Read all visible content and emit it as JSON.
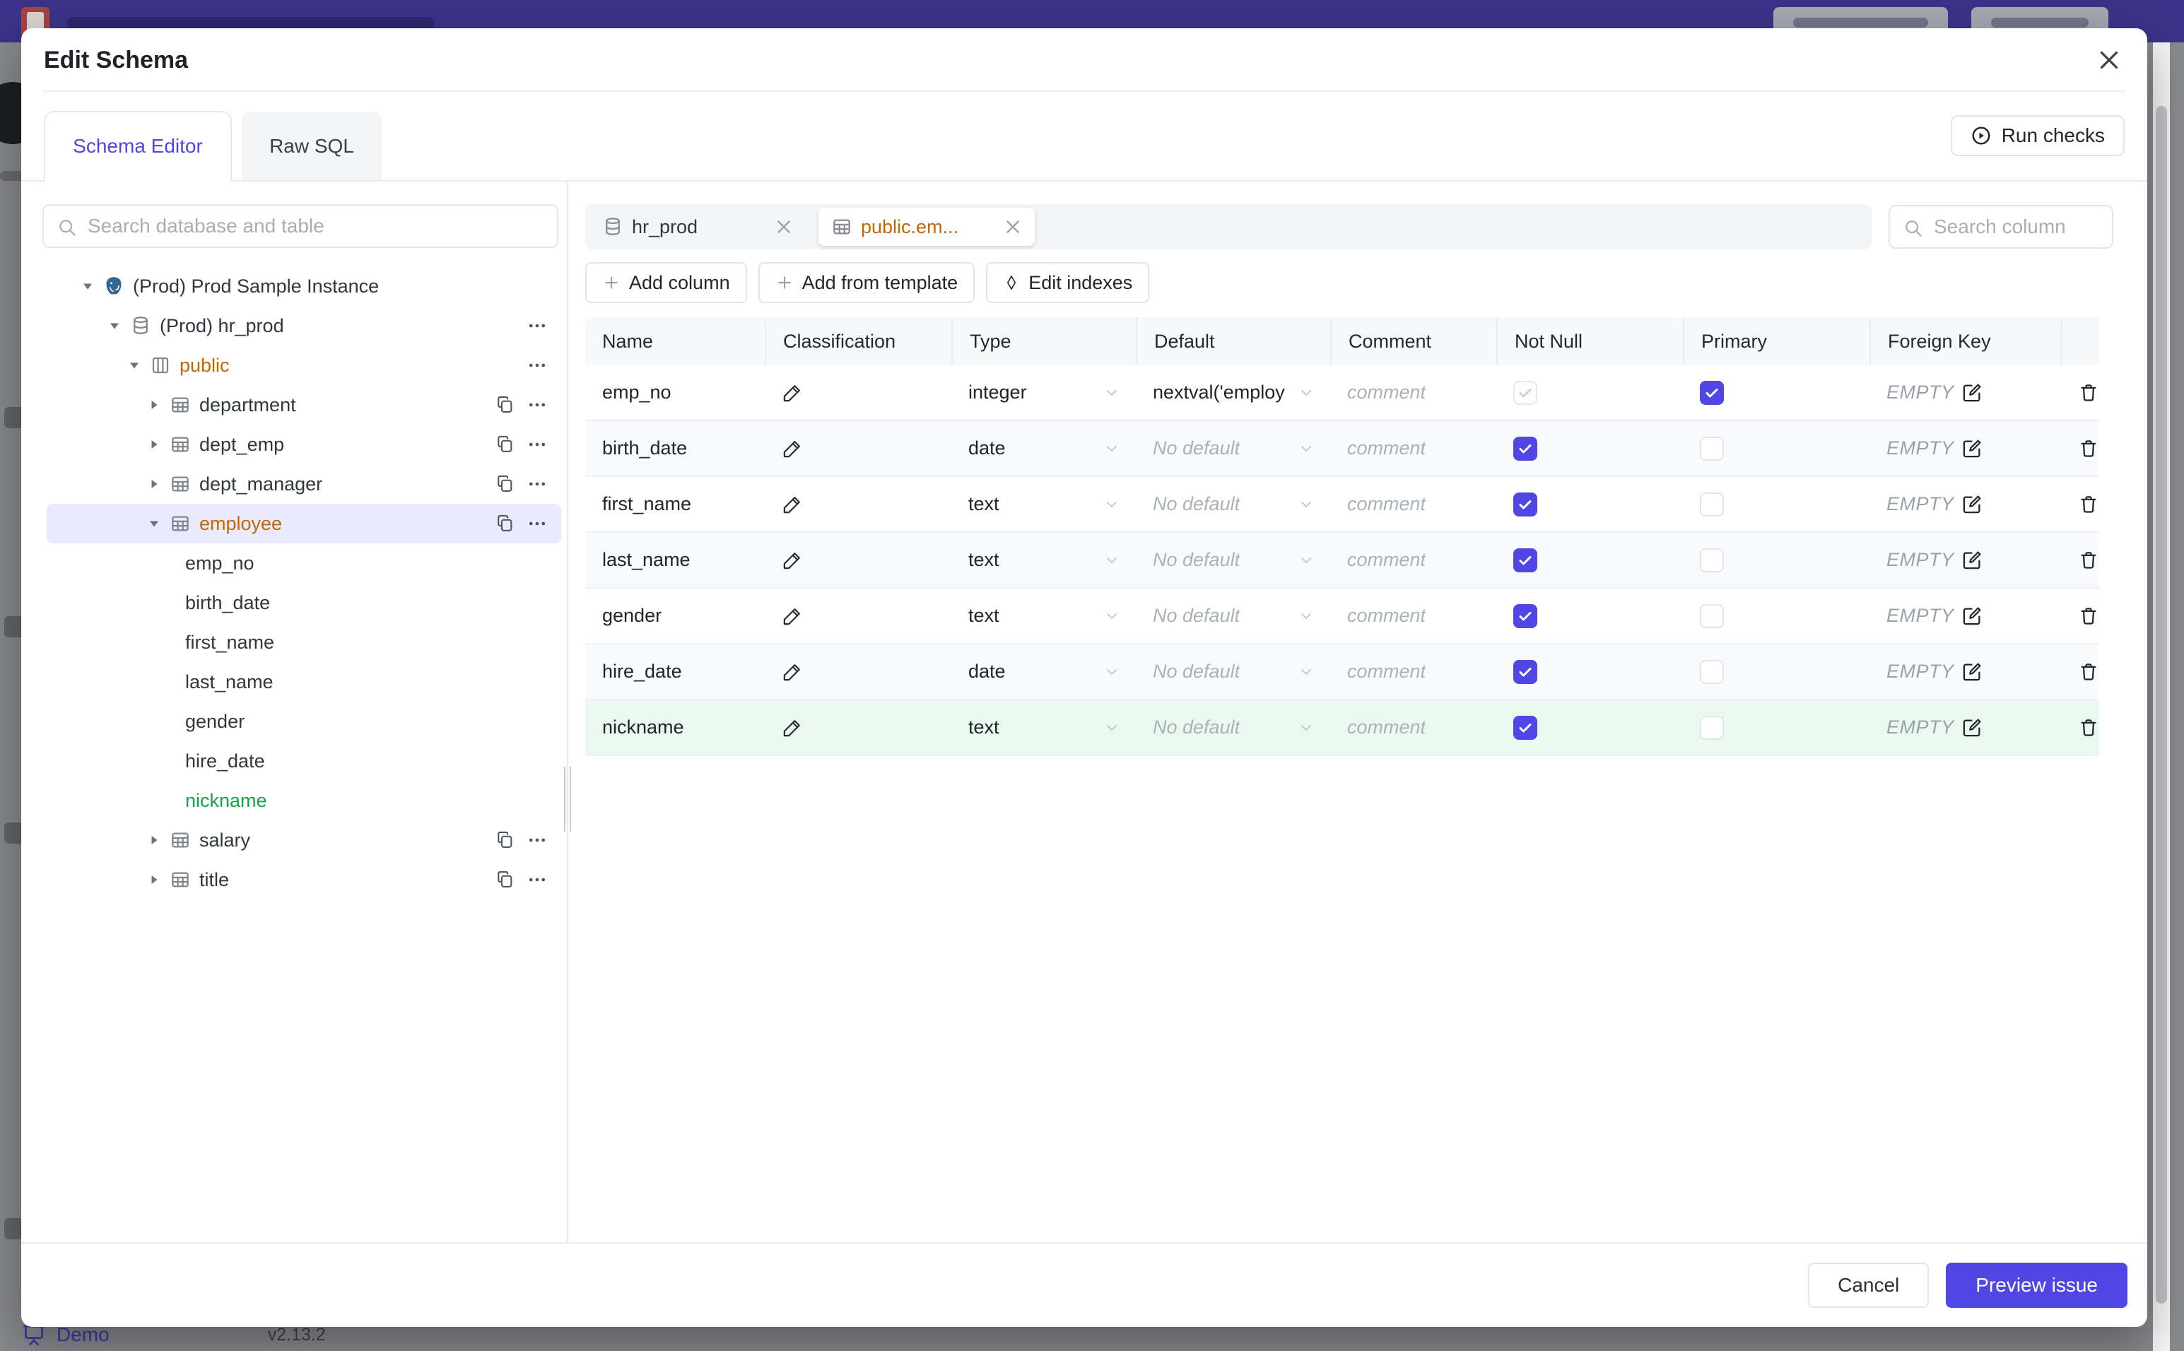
{
  "colors": {
    "accent": "#4f46e5",
    "amber": "#bf6a04",
    "green": "#16a34a",
    "topbar": "#3b3389",
    "selected_row_bg": "#eaeafc",
    "new_row_bg": "#e9f9ef"
  },
  "backdrop": {
    "demo_label": "Demo",
    "version": "v2.13.2"
  },
  "modal": {
    "title": "Edit Schema",
    "run_checks_label": "Run checks",
    "tabs": [
      {
        "label": "Schema Editor",
        "active": true
      },
      {
        "label": "Raw SQL",
        "active": false
      }
    ],
    "sidebar": {
      "search_placeholder": "Search database and table",
      "tree": [
        {
          "level": 0,
          "label": "(Prod) Prod Sample Instance",
          "icon": "postgres",
          "caret": "down",
          "actions": []
        },
        {
          "level": 1,
          "label": "(Prod) hr_prod",
          "icon": "database",
          "caret": "down",
          "actions": [
            "more"
          ]
        },
        {
          "level": 2,
          "label": "public",
          "icon": "schema",
          "caret": "down",
          "color": "amber",
          "actions": [
            "more"
          ]
        },
        {
          "level": 3,
          "label": "department",
          "icon": "table",
          "caret": "right",
          "actions": [
            "copy",
            "more"
          ]
        },
        {
          "level": 3,
          "label": "dept_emp",
          "icon": "table",
          "caret": "right",
          "actions": [
            "copy",
            "more"
          ]
        },
        {
          "level": 3,
          "label": "dept_manager",
          "icon": "table",
          "caret": "right",
          "actions": [
            "copy",
            "more"
          ]
        },
        {
          "level": 3,
          "label": "employee",
          "icon": "table",
          "caret": "down",
          "color": "amber",
          "selected": true,
          "actions": [
            "copy",
            "more"
          ]
        },
        {
          "level": 4,
          "label": "emp_no"
        },
        {
          "level": 4,
          "label": "birth_date"
        },
        {
          "level": 4,
          "label": "first_name"
        },
        {
          "level": 4,
          "label": "last_name"
        },
        {
          "level": 4,
          "label": "gender"
        },
        {
          "level": 4,
          "label": "hire_date"
        },
        {
          "level": 4,
          "label": "nickname",
          "color": "green"
        },
        {
          "level": 3,
          "label": "salary",
          "icon": "table",
          "caret": "right",
          "actions": [
            "copy",
            "more"
          ]
        },
        {
          "level": 3,
          "label": "title",
          "icon": "table",
          "caret": "right",
          "actions": [
            "copy",
            "more"
          ]
        }
      ]
    },
    "editor": {
      "chips": [
        {
          "label": "hr_prod",
          "icon": "database",
          "active": false,
          "color": "default"
        },
        {
          "label": "public.em...",
          "icon": "table",
          "active": true,
          "color": "amber"
        }
      ],
      "column_search_placeholder": "Search column",
      "toolbar": [
        {
          "label": "Add column",
          "icon": "plus"
        },
        {
          "label": "Add from template",
          "icon": "plus"
        },
        {
          "label": "Edit indexes",
          "icon": "diamond"
        }
      ],
      "table": {
        "headers": [
          "Name",
          "Classification",
          "Type",
          "Default",
          "Comment",
          "Not Null",
          "Primary",
          "Foreign Key",
          ""
        ],
        "comment_placeholder": "comment",
        "foreign_key_value": "EMPTY",
        "no_default_label": "No default",
        "rows": [
          {
            "name": "emp_no",
            "type": "integer",
            "default": "nextval('employ",
            "default_set": true,
            "not_null_checked": true,
            "not_null_disabled": true,
            "primary_checked": true,
            "highlight": "none"
          },
          {
            "name": "birth_date",
            "type": "date",
            "default": "",
            "default_set": false,
            "not_null_checked": true,
            "not_null_disabled": false,
            "primary_checked": false,
            "highlight": "stripe"
          },
          {
            "name": "first_name",
            "type": "text",
            "default": "",
            "default_set": false,
            "not_null_checked": true,
            "not_null_disabled": false,
            "primary_checked": false,
            "highlight": "none"
          },
          {
            "name": "last_name",
            "type": "text",
            "default": "",
            "default_set": false,
            "not_null_checked": true,
            "not_null_disabled": false,
            "primary_checked": false,
            "highlight": "stripe"
          },
          {
            "name": "gender",
            "type": "text",
            "default": "",
            "default_set": false,
            "not_null_checked": true,
            "not_null_disabled": false,
            "primary_checked": false,
            "highlight": "none"
          },
          {
            "name": "hire_date",
            "type": "date",
            "default": "",
            "default_set": false,
            "not_null_checked": true,
            "not_null_disabled": false,
            "primary_checked": false,
            "highlight": "stripe"
          },
          {
            "name": "nickname",
            "type": "text",
            "default": "",
            "default_set": false,
            "not_null_checked": true,
            "not_null_disabled": false,
            "primary_checked": false,
            "highlight": "new"
          }
        ]
      }
    },
    "footer": {
      "cancel_label": "Cancel",
      "primary_label": "Preview issue"
    }
  }
}
